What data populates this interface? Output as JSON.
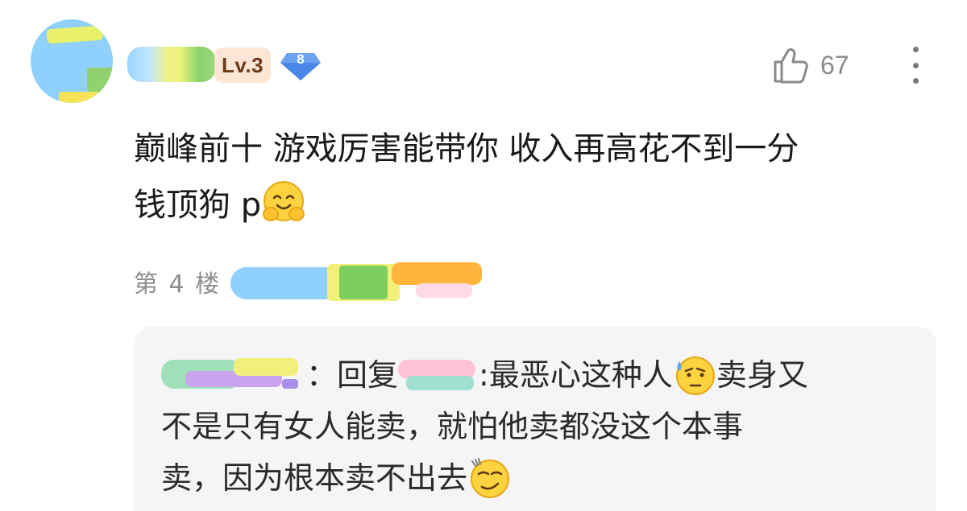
{
  "post": {
    "user": {
      "level": "Lv.3",
      "fan_badge_number": "8"
    },
    "like_count": "67",
    "content_line1": "巅峰前十 游戏厉害能带你 收入再高花不到一分",
    "content_line2": "钱顶狗 p",
    "floor_label": "第 4 楼"
  },
  "reply": {
    "sep1": "：",
    "reply_word": "回复",
    "sep2": ":",
    "text_part1": "最恶心这种人",
    "text_part2": "卖身又",
    "text_line2": "不是只有女人能卖，就怕他卖都没这个本事",
    "text_line3": "卖，因为根本卖不出去"
  },
  "icons": {
    "like": "thumbs-up-icon",
    "more": "more-vertical-icon",
    "emoji_hug": "hug-emoji-icon",
    "emoji_sweat": "sweat-emoji-icon",
    "emoji_smug": "smug-emoji-icon"
  },
  "colors": {
    "level_badge_bg": "#fde6d6",
    "level_badge_text": "#6b3b1b",
    "fan_badge": "#4a86e8",
    "reply_bg": "#f5f5f7"
  }
}
